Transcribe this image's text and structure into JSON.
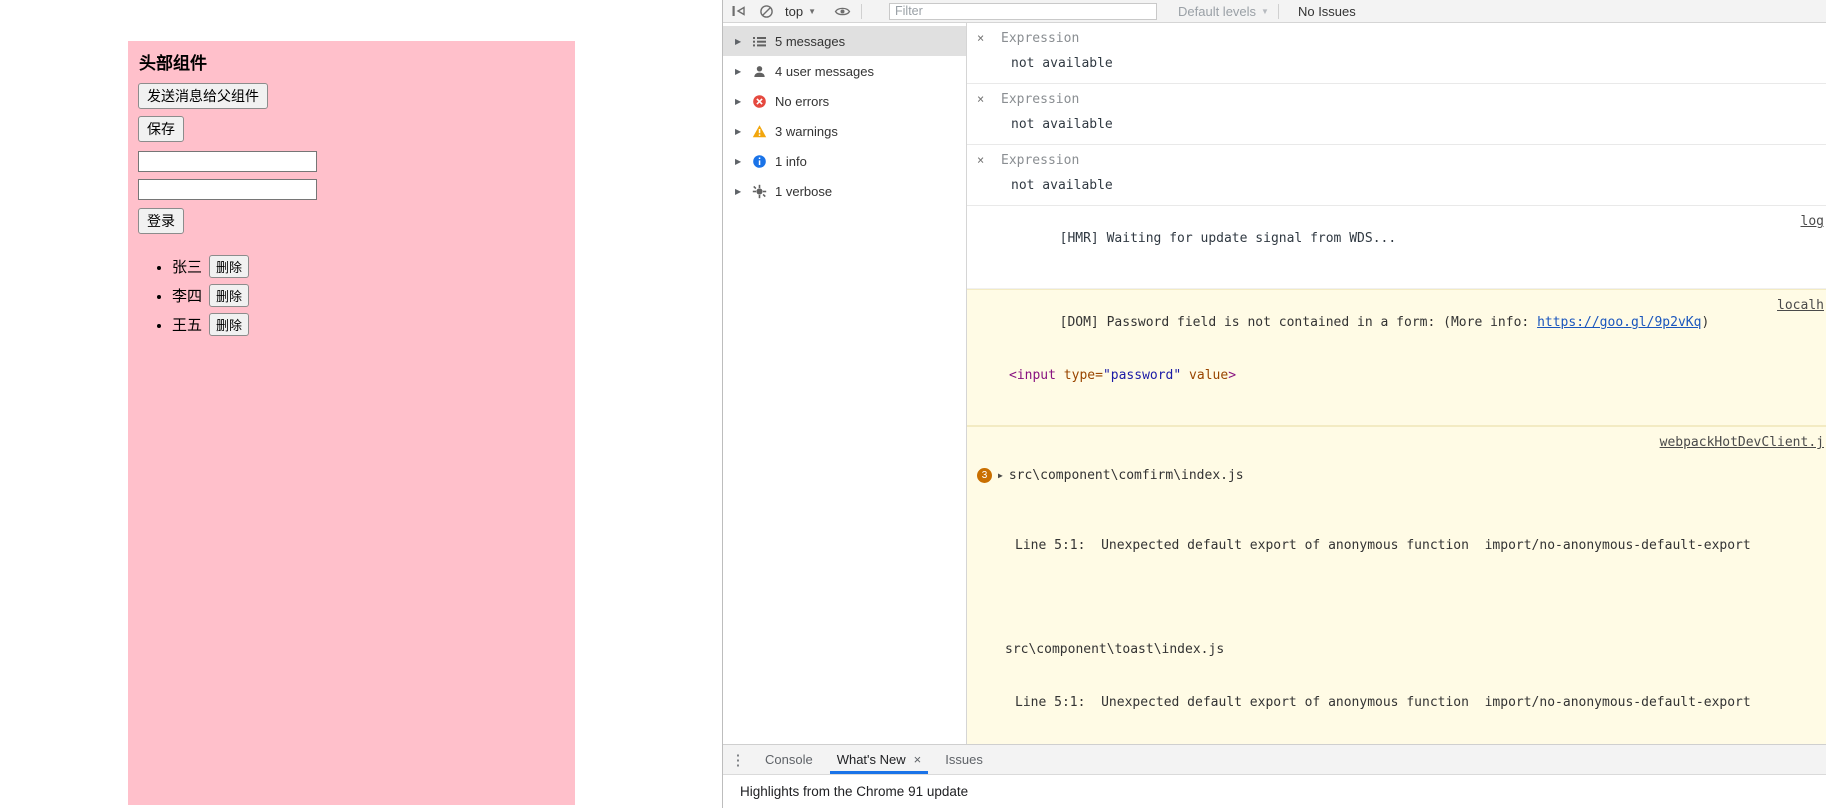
{
  "colors": {
    "pink_panel": "#ffc0cb",
    "warning_bg": "#fffbe5",
    "accent_blue": "#1a73e8"
  },
  "icons": {
    "close": "×",
    "menu": "⋮",
    "caret_down": "▼",
    "caret_right": "▶"
  },
  "page": {
    "title": "头部组件",
    "buttons": {
      "send": "发送消息给父组件",
      "save": "保存",
      "login": "登录"
    },
    "inputs": [
      {
        "value": ""
      },
      {
        "value": ""
      }
    ],
    "list": [
      {
        "name": "张三",
        "delete": "删除"
      },
      {
        "name": "李四",
        "delete": "删除"
      },
      {
        "name": "王五",
        "delete": "删除"
      }
    ]
  },
  "devtools": {
    "toolbar": {
      "sidebar_toggle_icon": "console-sidebar-toggle-icon",
      "clear_icon": "clear-console-icon",
      "context": "top",
      "eye_icon": "create-live-expression-icon",
      "filter_placeholder": "Filter",
      "levels": "Default levels",
      "issues": "No Issues"
    },
    "sidebar": [
      {
        "icon": "messages-list-icon",
        "label": "5 messages",
        "selected": true
      },
      {
        "icon": "user-icon",
        "label": "4 user messages",
        "selected": false
      },
      {
        "icon": "error-icon",
        "label": "No errors",
        "selected": false
      },
      {
        "icon": "warning-icon",
        "label": "3 warnings",
        "selected": false
      },
      {
        "icon": "info-icon",
        "label": "1 info",
        "selected": false
      },
      {
        "icon": "verbose-icon",
        "label": "1 verbose",
        "selected": false
      }
    ],
    "live_expressions": [
      {
        "title": "Expression",
        "result": "not available"
      },
      {
        "title": "Expression",
        "result": "not available"
      },
      {
        "title": "Expression",
        "result": "not available"
      }
    ],
    "console": {
      "hmr": {
        "text": "[HMR] Waiting for update signal from WDS...",
        "source": "log"
      },
      "dom_warning": {
        "prefix": "[DOM] Password field is not contained in a form: (More info: ",
        "link": "https://goo.gl/9p2vKq",
        "suffix": ") ",
        "source": "localh",
        "element": {
          "tag_open": "<input",
          "attr1": " type=",
          "value1": "\"password\"",
          "attr2": " value",
          "tag_close": ">"
        }
      },
      "eslint": {
        "badge": "3",
        "file1": "src\\component\\comfirm\\index.js",
        "source": "webpackHotDevClient.j",
        "detail1": "Line 5:1:  Unexpected default export of anonymous function  import/no-anonymous-default-export",
        "file2": "src\\component\\toast\\index.js",
        "detail2": "Line 5:1:  Unexpected default export of anonymous function  import/no-anonymous-default-export"
      },
      "prompt_chevron": ">"
    },
    "drawer": {
      "tabs": [
        {
          "label": "Console",
          "active": false
        },
        {
          "label": "What's New",
          "active": true
        },
        {
          "label": "Issues",
          "active": false
        }
      ],
      "content_title": "Highlights from the Chrome 91 update"
    }
  }
}
